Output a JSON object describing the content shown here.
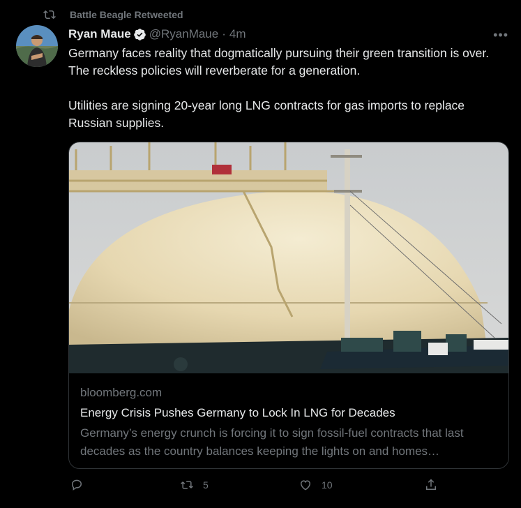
{
  "retweet": {
    "label": "Battle Beagle Retweeted"
  },
  "author": {
    "name": "Ryan Maue",
    "handle": "@RyanMaue",
    "separator": "·",
    "time": "4m"
  },
  "menu": {
    "more": "•••"
  },
  "tweet": {
    "text": "Germany faces reality that dogmatically pursuing their green transition is over.  The reckless policies will reverberate for a generation.\n\nUtilities are signing 20-year long LNG contracts for gas imports to replace Russian supplies."
  },
  "card": {
    "domain": "bloomberg.com",
    "title": "Energy Crisis Pushes Germany to Lock In LNG for Decades",
    "description": "Germany’s energy crunch is forcing it to sign fossil-fuel contracts that last decades as the country balances keeping the lights on and homes…"
  },
  "actions": {
    "reply_count": "",
    "retweet_count": "5",
    "like_count": "10"
  },
  "colors": {
    "background": "#000000",
    "primary_text": "#e7e9ea",
    "secondary_text": "#71767b",
    "verified": "#1d9bf0",
    "border": "#2f3336"
  }
}
